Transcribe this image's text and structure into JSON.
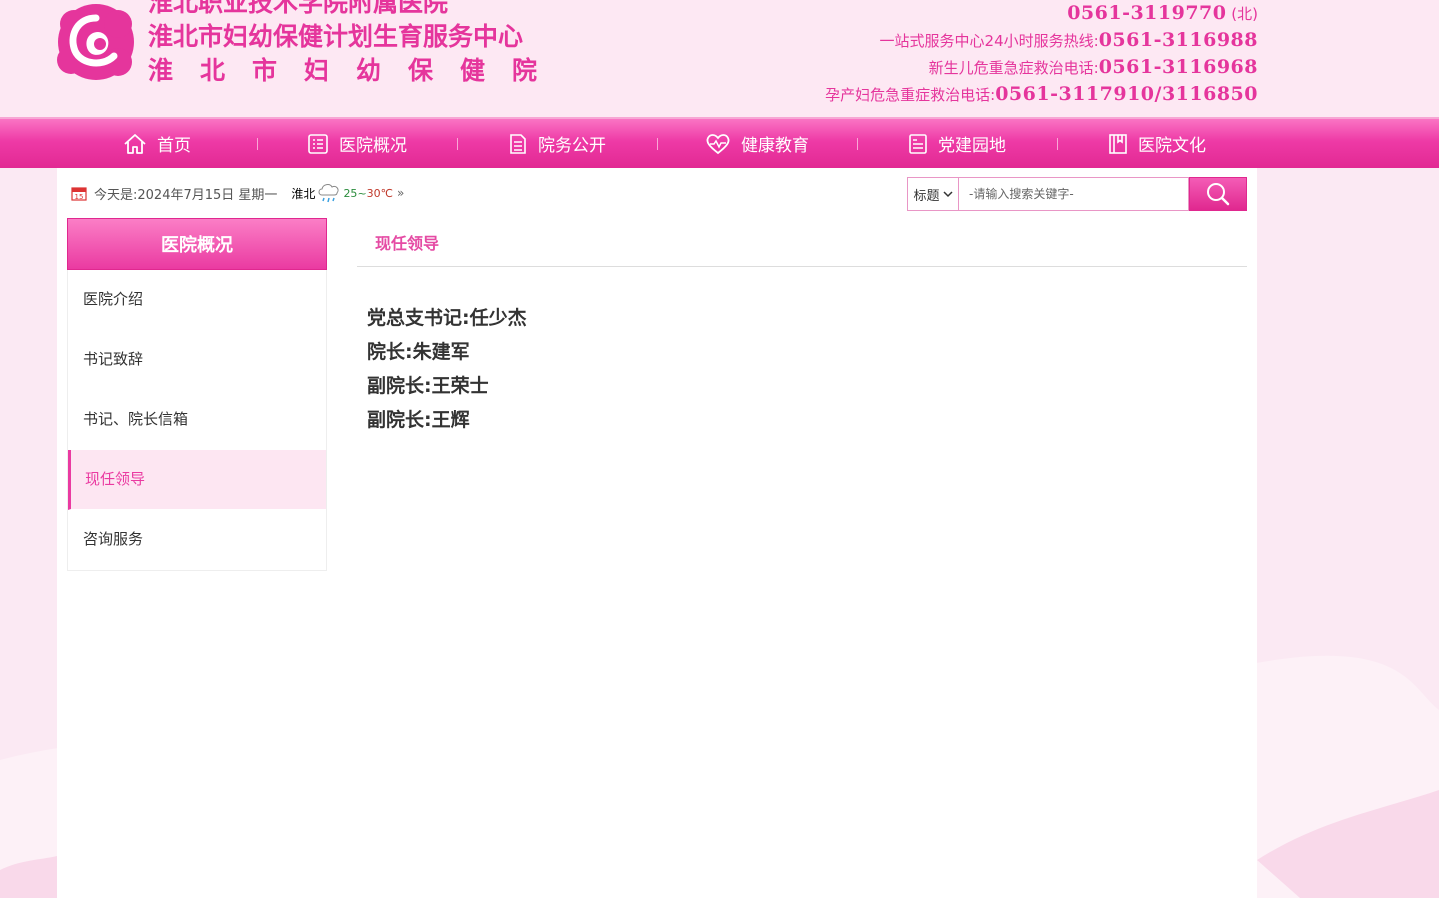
{
  "header": {
    "title_lines": [
      "淮北职业技术学院附属医院",
      "淮北市妇幼保健计划生育服务中心",
      "淮北市妇幼保健院"
    ],
    "hotlines": [
      {
        "label": "",
        "number": "0561-3119770",
        "suffix": "(北)"
      },
      {
        "label": "一站式服务中心24小时服务热线:",
        "number": "0561-3116988",
        "suffix": ""
      },
      {
        "label": "新生儿危重急症救治电话:",
        "number": "0561-3116968",
        "suffix": ""
      },
      {
        "label": "孕产妇危急重症救治电话:",
        "number": "0561-3117910/3116850",
        "suffix": ""
      }
    ],
    "brand_color": "#e5359c"
  },
  "nav": {
    "items": [
      {
        "label": "首页",
        "icon": "home-icon"
      },
      {
        "label": "医院概况",
        "icon": "list-icon"
      },
      {
        "label": "院务公开",
        "icon": "document-icon"
      },
      {
        "label": "健康教育",
        "icon": "heart-pulse-icon"
      },
      {
        "label": "党建园地",
        "icon": "notes-icon"
      },
      {
        "label": "医院文化",
        "icon": "book-icon"
      }
    ]
  },
  "infobar": {
    "date_text": "今天是:2024年7月15日 星期一",
    "city": "淮北",
    "weather_icon": "rain-cloud-icon",
    "temp_low": "25",
    "temp_sep": "~",
    "temp_high": "30℃",
    "more": "»"
  },
  "search": {
    "select_value": "标题",
    "placeholder": "-请输入搜索关键字-",
    "button_icon": "search-icon"
  },
  "sidebar": {
    "title": "医院概况",
    "items": [
      {
        "label": "医院介绍",
        "active": false
      },
      {
        "label": "书记致辞",
        "active": false
      },
      {
        "label": "书记、院长信箱",
        "active": false
      },
      {
        "label": "现任领导",
        "active": true
      },
      {
        "label": "咨询服务",
        "active": false
      }
    ]
  },
  "main": {
    "title": "现任领导",
    "lines": [
      "党总支书记:任少杰",
      "院长:朱建军",
      "副院长:王荣士",
      "副院长:王辉"
    ]
  }
}
